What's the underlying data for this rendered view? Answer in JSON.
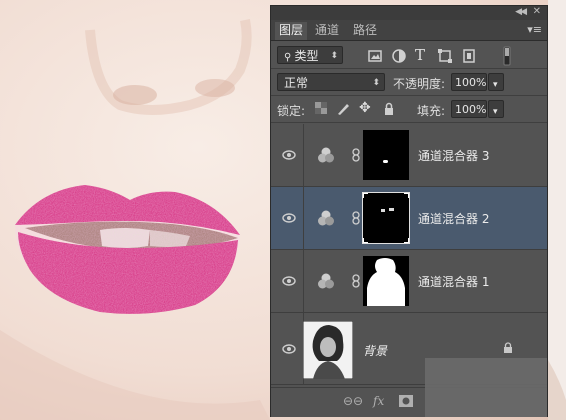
{
  "colors": {
    "panel_bg": "#535353",
    "selected_layer": "#4a5a6e",
    "lip_pink": "#d4307f"
  },
  "panel": {
    "tabs": [
      {
        "label": "图层"
      },
      {
        "label": "通道"
      },
      {
        "label": "路径"
      }
    ],
    "filter": {
      "kind_label": "类型"
    },
    "blend": {
      "mode": "正常",
      "opacity_label": "不透明度:",
      "opacity_value": "100%"
    },
    "lock": {
      "label": "锁定:",
      "fill_label": "填充:",
      "fill_value": "100%"
    },
    "layers": [
      {
        "name": "通道混合器 3",
        "type": "channel-mixer",
        "visible": true,
        "selected": false
      },
      {
        "name": "通道混合器 2",
        "type": "channel-mixer",
        "visible": true,
        "selected": true
      },
      {
        "name": "通道混合器 1",
        "type": "channel-mixer",
        "visible": true,
        "selected": false
      },
      {
        "name": "背景",
        "type": "background",
        "visible": true,
        "locked": true
      }
    ],
    "bottom_icons": [
      "link-icon",
      "fx-icon",
      "mask-icon"
    ],
    "fx_label": "fx"
  }
}
